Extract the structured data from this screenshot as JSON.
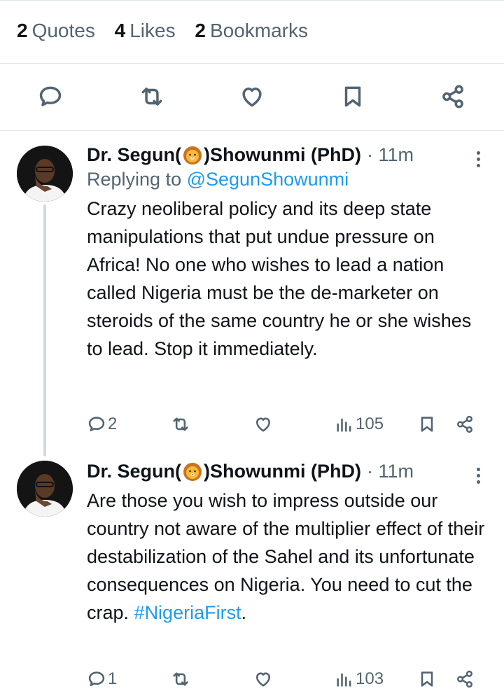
{
  "stats": [
    {
      "count": "2",
      "label": "Quotes"
    },
    {
      "count": "4",
      "label": "Likes"
    },
    {
      "count": "2",
      "label": "Bookmarks"
    }
  ],
  "action_icons": [
    "reply-icon",
    "retweet-icon",
    "like-icon",
    "bookmark-icon",
    "share-icon"
  ],
  "tweets": [
    {
      "name_prefix": "Dr. Segun(",
      "name_suffix": ")Showunmi (PhD)",
      "emoji": "lion-face-emoji",
      "time": "· 11m",
      "replying_label": "Replying to",
      "replying_handle": "@SegunShowunmi",
      "text": "Crazy neoliberal policy and its deep state manipulations that put undue pressure on Africa! No one who wishes to lead a nation called Nigeria must be the de-marketer on steroids of the same country he or she wishes to lead. Stop it immediately.",
      "replies": "2",
      "retweets": "",
      "likes": "",
      "views": "105"
    },
    {
      "name_prefix": "Dr. Segun(",
      "name_suffix": ")Showunmi (PhD)",
      "emoji": "lion-face-emoji",
      "time": "· 11m",
      "text": "Are those you wish to impress outside our country not aware of the multiplier effect of their destabilization of the Sahel and its unfortunate consequences on Nigeria. You need to cut the crap.",
      "hashtag": "#NigeriaFirst",
      "hashtag_trailing": ".",
      "replies": "1",
      "retweets": "",
      "likes": "",
      "views": "103"
    }
  ],
  "colors": {
    "text": "#0f1419",
    "muted": "#536471",
    "link": "#1d9bf0",
    "divider": "#e1e6ea"
  }
}
